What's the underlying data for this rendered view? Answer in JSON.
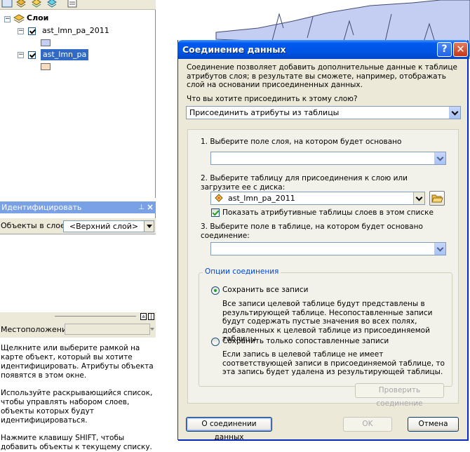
{
  "toc": {
    "root_label": "Слои",
    "layers": [
      {
        "name": "ast_lmn_pa_2011",
        "swatch": "#c4cdf2",
        "checked": true
      },
      {
        "name": "ast_lmn_pa",
        "swatch": "#f7dcc0",
        "checked": true,
        "selected": true
      }
    ]
  },
  "identify": {
    "title": "Идентифицировать",
    "layers_label": "Объекты в слое:",
    "layers_value": "<Верхний слой>",
    "location_label": "Местоположение:",
    "help_paragraphs": [
      "Щелкните или выберите рамкой на карте объект, который вы хотите идентифицировать. Атрибуты объекта появятся в этом окне.",
      "Используйте раскрывающийся список, чтобы управлять набором слоев, объекты которых будут идентифицироваться.",
      "Нажмите клавишу SHIFT, чтобы добавить объекты к текущему списку."
    ]
  },
  "dialog": {
    "title": "Соединение данных",
    "description": "Соединение позволяет добавить дополнительные данные к таблице атрибутов слоя; в результате вы сможете, например, отображать слой на основании присоединенных данных.",
    "question": "Что вы хотите присоединить к этому слою?",
    "join_type_value": "Присоединить атрибуты из таблицы",
    "step1_label": "1.  Выберите поле слоя, на котором будет основано",
    "step1_value": "",
    "step2_label": "2.  Выберите таблицу для присоединения к слою или загрузите ее с диска:",
    "step2_value": "ast_lmn_pa_2011",
    "show_attr_tables_label": "Показать атрибутивные таблицы слоев в этом списке",
    "show_attr_tables_checked": true,
    "step3_label": "3.  Выберите поле в таблице, на котором будет основано соединение:",
    "step3_value": "",
    "options_title": "Опции соединения",
    "keep_all_label": "Сохранить все записи",
    "keep_all_desc": "Все записи целевой таблице будут представлены в результирующей таблице. Несопоставленные записи будут содержать пустые значения во всех полях, добавленных к целевой таблице из присоединяемой таблицы.",
    "keep_matching_label": "Сохранить только сопоставленные записи",
    "keep_matching_desc": "Если запись в целевой таблице не имеет соответствующей записи в присоединяемой таблице, то эта запись будет удалена из результирующей таблицы.",
    "validate_label": "Проверить соединение",
    "about_label": "О соединении данных",
    "ok_label": "OK",
    "cancel_label": "Отмена",
    "help_glyph": "?",
    "close_glyph": "✕"
  },
  "colors": {
    "titlebar": "#0055e5",
    "map_polygon": "#c4cdf2",
    "dock_title": "#7aa1e6",
    "accent_text": "#0046d5"
  }
}
